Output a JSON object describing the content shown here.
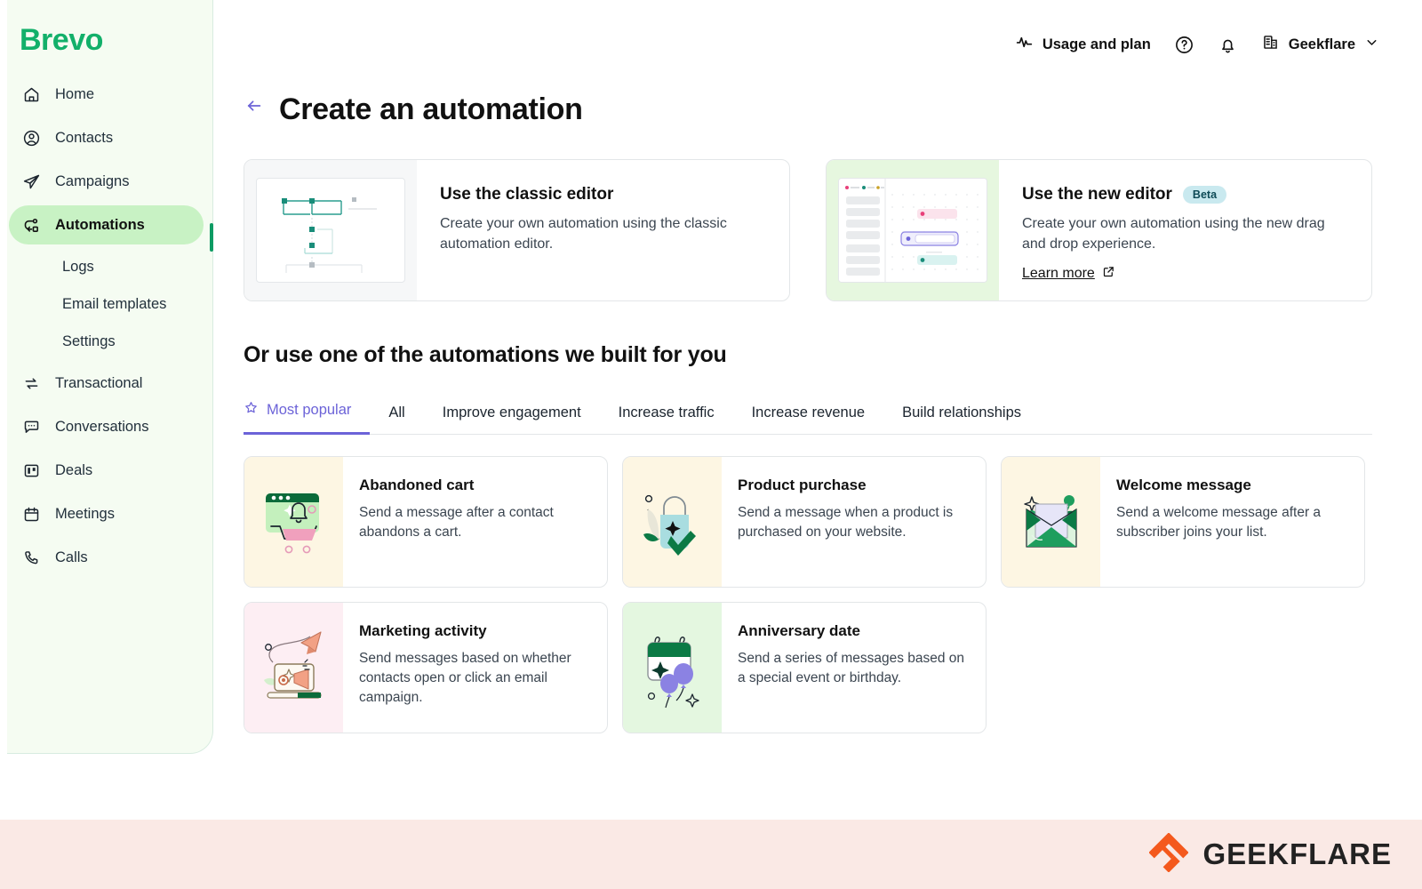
{
  "brand": {
    "name": "Brevo",
    "color": "#12b06a"
  },
  "sidebar": {
    "items": [
      {
        "label": "Home",
        "icon": "home-icon"
      },
      {
        "label": "Contacts",
        "icon": "user-circle-icon"
      },
      {
        "label": "Campaigns",
        "icon": "paper-plane-icon"
      },
      {
        "label": "Automations",
        "icon": "automation-icon",
        "active": true
      }
    ],
    "sub_items": [
      {
        "label": "Logs"
      },
      {
        "label": "Email templates"
      },
      {
        "label": "Settings"
      }
    ],
    "items_lower": [
      {
        "label": "Transactional",
        "icon": "exchange-icon"
      },
      {
        "label": "Conversations",
        "icon": "chat-icon"
      },
      {
        "label": "Deals",
        "icon": "board-icon"
      },
      {
        "label": "Meetings",
        "icon": "calendar-icon"
      },
      {
        "label": "Calls",
        "icon": "phone-icon"
      }
    ]
  },
  "topbar": {
    "usage_label": "Usage and plan",
    "help_icon": "question-circle-icon",
    "notifications_icon": "bell-icon",
    "account_name": "Geekflare",
    "account_icon": "building-icon",
    "chevron": "chevron-down-icon"
  },
  "page": {
    "back_icon": "back-arrow-icon",
    "title": "Create an automation",
    "section_title": "Or use one of the automations we built for you"
  },
  "editors": [
    {
      "title": "Use the classic editor",
      "desc": "Create your own automation using the classic automation editor.",
      "badge": null,
      "link": null,
      "thumb": "classic-editor-preview"
    },
    {
      "title": "Use the new editor",
      "desc": "Create your own automation using the new drag and drop experience.",
      "badge": "Beta",
      "link": "Learn more",
      "link_icon": "external-link-icon",
      "thumb": "new-editor-preview"
    }
  ],
  "tabs": [
    {
      "label": "Most popular",
      "icon": "star-icon",
      "active": true
    },
    {
      "label": "All",
      "active": false
    },
    {
      "label": "Improve engagement",
      "active": false
    },
    {
      "label": "Increase traffic",
      "active": false
    },
    {
      "label": "Increase revenue",
      "active": false
    },
    {
      "label": "Build relationships",
      "active": false
    }
  ],
  "automations": [
    {
      "title": "Abandoned cart",
      "desc": "Send a message after a contact abandons a cart.",
      "thumb_bg": "#fdf6e3",
      "illustration": "abandoned-cart-illustration"
    },
    {
      "title": "Product purchase",
      "desc": "Send a message when a product is purchased on your website.",
      "thumb_bg": "#fdf6e3",
      "illustration": "shopping-bag-illustration"
    },
    {
      "title": "Welcome message",
      "desc": "Send a welcome message after a subscriber joins your list.",
      "thumb_bg": "#fdf6e3",
      "illustration": "envelope-illustration"
    },
    {
      "title": "Marketing activity",
      "desc": "Send messages based on whether contacts open or click an email campaign.",
      "thumb_bg": "#fdeef3",
      "illustration": "laptop-megaphone-illustration"
    },
    {
      "title": "Anniversary date",
      "desc": "Send a series of messages based on a special event or birthday.",
      "thumb_bg": "#e4f7e0",
      "illustration": "calendar-balloons-illustration"
    }
  ],
  "footer": {
    "watermark_name": "GEEKFLARE",
    "logo_color": "#f4591d",
    "strip_color": "#fae9e5"
  },
  "colors": {
    "accent_green": "#12b06a",
    "accent_purple": "#6c63d8",
    "active_nav_bg": "#c8f2c4",
    "sidebar_bg": "#f5fcf2"
  }
}
